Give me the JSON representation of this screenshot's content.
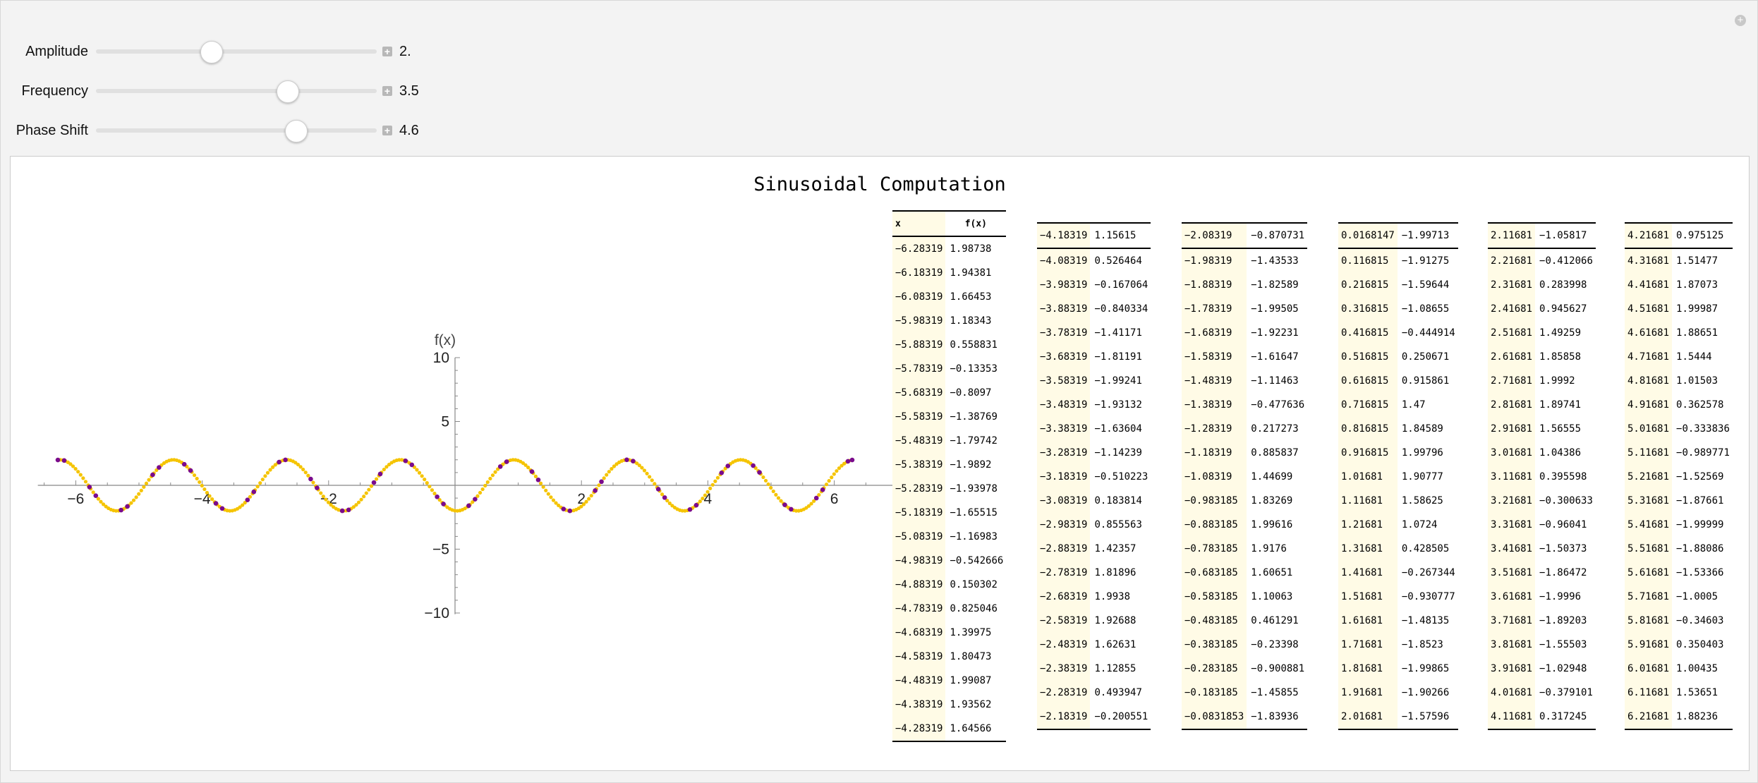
{
  "controls": [
    {
      "label": "Amplitude",
      "value": "2.",
      "fraction": 0.41
    },
    {
      "label": "Frequency",
      "value": "3.5",
      "fraction": 0.68
    },
    {
      "label": "Phase Shift",
      "value": "4.6",
      "fraction": 0.71
    }
  ],
  "output": {
    "title": "Sinusoidal Computation",
    "table_headers": [
      "x",
      "f(x)"
    ]
  },
  "chart_data": {
    "type": "scatter",
    "x_axis_label": "x",
    "y_axis_label": "f(x)",
    "xlim": [
      -6.6,
      6.6
    ],
    "ylim": [
      -10,
      10
    ],
    "x_ticks": [
      "−6",
      "−4",
      "−2",
      "2",
      "4",
      "6"
    ],
    "y_ticks": [
      "10",
      "5",
      "−5",
      "−10"
    ],
    "curve_color": "#f5c400",
    "point_color": "#7a0b8c",
    "function": {
      "amplitude": 2,
      "frequency": 3.5,
      "phase_shift": 4.6
    },
    "points_x": [
      -6.28319,
      -5.78319,
      -5.28319,
      -4.78319,
      -4.28319,
      -3.78319,
      -3.28319,
      -2.78319,
      -2.28319,
      -1.78319,
      -1.28319,
      -0.783185,
      -0.283185,
      0.216815,
      0.716815,
      1.21681,
      1.71681,
      2.21681,
      2.71681,
      3.21681,
      3.71681,
      4.21681,
      4.71681,
      5.21681,
      5.71681,
      6.21681,
      -6.18319,
      -5.68319,
      -5.18319,
      -4.68319,
      -4.18319,
      -3.68319,
      -3.18319,
      -2.68319,
      -2.18319,
      -1.68319,
      -1.18319,
      -0.683185,
      -0.183185,
      0.316815,
      0.816815,
      1.31681,
      1.81681,
      2.31681,
      2.81681,
      3.31681,
      3.81681,
      4.31681,
      4.81681,
      5.31681,
      5.81681,
      6.28319
    ]
  },
  "table_columns": [
    {
      "header": true,
      "rows": [
        [
          "-6.28319",
          "1.98738"
        ],
        [
          "-6.18319",
          "1.94381"
        ],
        [
          "-6.08319",
          "1.66453"
        ],
        [
          "-5.98319",
          "1.18343"
        ],
        [
          "-5.88319",
          "0.558831"
        ],
        [
          "-5.78319",
          "-0.13353"
        ],
        [
          "-5.68319",
          "-0.8097"
        ],
        [
          "-5.58319",
          "-1.38769"
        ],
        [
          "-5.48319",
          "-1.79742"
        ],
        [
          "-5.38319",
          "-1.9892"
        ],
        [
          "-5.28319",
          "-1.93978"
        ],
        [
          "-5.18319",
          "-1.65515"
        ],
        [
          "-5.08319",
          "-1.16983"
        ],
        [
          "-4.98319",
          "-0.542666"
        ],
        [
          "-4.88319",
          "0.150302"
        ],
        [
          "-4.78319",
          "0.825046"
        ],
        [
          "-4.68319",
          "1.39975"
        ],
        [
          "-4.58319",
          "1.80473"
        ],
        [
          "-4.48319",
          "1.99087"
        ],
        [
          "-4.38319",
          "1.93562"
        ],
        [
          "-4.28319",
          "1.64566"
        ]
      ]
    },
    {
      "header": false,
      "rows": [
        [
          "-4.18319",
          "1.15615"
        ],
        [
          "-4.08319",
          "0.526464"
        ],
        [
          "-3.98319",
          "-0.167064"
        ],
        [
          "-3.88319",
          "-0.840334"
        ],
        [
          "-3.78319",
          "-1.41171"
        ],
        [
          "-3.68319",
          "-1.81191"
        ],
        [
          "-3.58319",
          "-1.99241"
        ],
        [
          "-3.48319",
          "-1.93132"
        ],
        [
          "-3.38319",
          "-1.63604"
        ],
        [
          "-3.28319",
          "-1.14239"
        ],
        [
          "-3.18319",
          "-0.510223"
        ],
        [
          "-3.08319",
          "0.183814"
        ],
        [
          "-2.98319",
          "0.855563"
        ],
        [
          "-2.88319",
          "1.42357"
        ],
        [
          "-2.78319",
          "1.81896"
        ],
        [
          "-2.68319",
          "1.9938"
        ],
        [
          "-2.58319",
          "1.92688"
        ],
        [
          "-2.48319",
          "1.62631"
        ],
        [
          "-2.38319",
          "1.12855"
        ],
        [
          "-2.28319",
          "0.493947"
        ],
        [
          "-2.18319",
          "-0.200551"
        ]
      ]
    },
    {
      "header": false,
      "rows": [
        [
          "-2.08319",
          "-0.870731"
        ],
        [
          "-1.98319",
          "-1.43533"
        ],
        [
          "-1.88319",
          "-1.82589"
        ],
        [
          "-1.78319",
          "-1.99505"
        ],
        [
          "-1.68319",
          "-1.92231"
        ],
        [
          "-1.58319",
          "-1.61647"
        ],
        [
          "-1.48319",
          "-1.11463"
        ],
        [
          "-1.38319",
          "-0.477636"
        ],
        [
          "-1.28319",
          "0.217273"
        ],
        [
          "-1.18319",
          "0.885837"
        ],
        [
          "-1.08319",
          "1.44699"
        ],
        [
          "-0.983185",
          "1.83269"
        ],
        [
          "-0.883185",
          "1.99616"
        ],
        [
          "-0.783185",
          "1.9176"
        ],
        [
          "-0.683185",
          "1.60651"
        ],
        [
          "-0.583185",
          "1.10063"
        ],
        [
          "-0.483185",
          "0.461291"
        ],
        [
          "-0.383185",
          "-0.23398"
        ],
        [
          "-0.283185",
          "-0.900881"
        ],
        [
          "-0.183185",
          "-1.45855"
        ],
        [
          "-0.0831853",
          "-1.83936"
        ]
      ]
    },
    {
      "header": false,
      "rows": [
        [
          "0.0168147",
          "-1.99713"
        ],
        [
          "0.116815",
          "-1.91275"
        ],
        [
          "0.216815",
          "-1.59644"
        ],
        [
          "0.316815",
          "-1.08655"
        ],
        [
          "0.416815",
          "-0.444914"
        ],
        [
          "0.516815",
          "0.250671"
        ],
        [
          "0.616815",
          "0.915861"
        ],
        [
          "0.716815",
          "1.47"
        ],
        [
          "0.816815",
          "1.84589"
        ],
        [
          "0.916815",
          "1.99796"
        ],
        [
          "1.01681",
          "1.90777"
        ],
        [
          "1.11681",
          "1.58625"
        ],
        [
          "1.21681",
          "1.0724"
        ],
        [
          "1.31681",
          "0.428505"
        ],
        [
          "1.41681",
          "-0.267344"
        ],
        [
          "1.51681",
          "-0.930777"
        ],
        [
          "1.61681",
          "-1.48135"
        ],
        [
          "1.71681",
          "-1.8523"
        ],
        [
          "1.81681",
          "-1.99865"
        ],
        [
          "1.91681",
          "-1.90266"
        ],
        [
          "2.01681",
          "-1.57596"
        ]
      ]
    },
    {
      "header": false,
      "rows": [
        [
          "2.11681",
          "-1.05817"
        ],
        [
          "2.21681",
          "-0.412066"
        ],
        [
          "2.31681",
          "0.283998"
        ],
        [
          "2.41681",
          "0.945627"
        ],
        [
          "2.51681",
          "1.49259"
        ],
        [
          "2.61681",
          "1.85858"
        ],
        [
          "2.71681",
          "1.9992"
        ],
        [
          "2.81681",
          "1.89741"
        ],
        [
          "2.91681",
          "1.56555"
        ],
        [
          "3.01681",
          "1.04386"
        ],
        [
          "3.11681",
          "0.395598"
        ],
        [
          "3.21681",
          "-0.300633"
        ],
        [
          "3.31681",
          "-0.96041"
        ],
        [
          "3.41681",
          "-1.50373"
        ],
        [
          "3.51681",
          "-1.86472"
        ],
        [
          "3.61681",
          "-1.9996"
        ],
        [
          "3.71681",
          "-1.89203"
        ],
        [
          "3.81681",
          "-1.55503"
        ],
        [
          "3.91681",
          "-1.02948"
        ],
        [
          "4.01681",
          "-0.379101"
        ],
        [
          "4.11681",
          "0.317245"
        ]
      ]
    },
    {
      "header": false,
      "rows": [
        [
          "4.21681",
          "0.975125"
        ],
        [
          "4.31681",
          "1.51477"
        ],
        [
          "4.41681",
          "1.87073"
        ],
        [
          "4.51681",
          "1.99987"
        ],
        [
          "4.61681",
          "1.88651"
        ],
        [
          "4.71681",
          "1.5444"
        ],
        [
          "4.81681",
          "1.01503"
        ],
        [
          "4.91681",
          "0.362578"
        ],
        [
          "5.01681",
          "-0.333836"
        ],
        [
          "5.11681",
          "-0.989771"
        ],
        [
          "5.21681",
          "-1.52569"
        ],
        [
          "5.31681",
          "-1.87661"
        ],
        [
          "5.41681",
          "-1.99999"
        ],
        [
          "5.51681",
          "-1.88086"
        ],
        [
          "5.61681",
          "-1.53366"
        ],
        [
          "5.71681",
          "-1.0005"
        ],
        [
          "5.81681",
          "-0.34603"
        ],
        [
          "5.91681",
          "0.350403"
        ],
        [
          "6.01681",
          "1.00435"
        ],
        [
          "6.11681",
          "1.53651"
        ],
        [
          "6.21681",
          "1.88236"
        ]
      ]
    }
  ]
}
